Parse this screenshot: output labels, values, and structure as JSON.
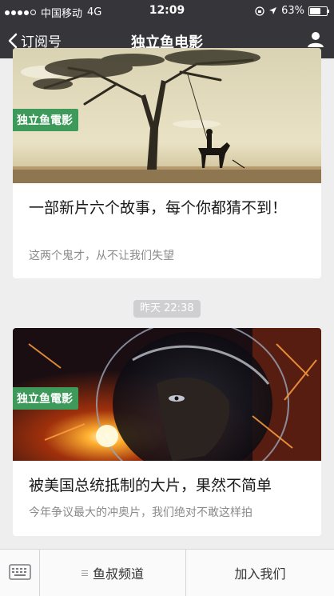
{
  "status_bar": {
    "carrier": "中国移动",
    "network": "4G",
    "time": "12:09",
    "battery": "63%",
    "battery_level": 0.63
  },
  "nav": {
    "back_label": "订阅号",
    "title": "独立鱼电影"
  },
  "articles": [
    {
      "tag": "独立鱼電影",
      "headline": "一部新片六个故事，每个你都猜不到！",
      "subtitle": "这两个鬼才，从不让我们失望"
    },
    {
      "tag": "独立鱼電影",
      "headline": "被美国总统抵制的大片，果然不简单",
      "subtitle": "今年争议最大的冲奥片，我们绝对不敢这样拍"
    }
  ],
  "timestamp": "昨天 22:38",
  "bottom_menu": {
    "item1": "鱼叔频道",
    "item2": "加入我们"
  },
  "colors": {
    "bar_bg": "#35353a",
    "tag_green": "#3d9a5a",
    "page_bg": "#eeeeef"
  }
}
